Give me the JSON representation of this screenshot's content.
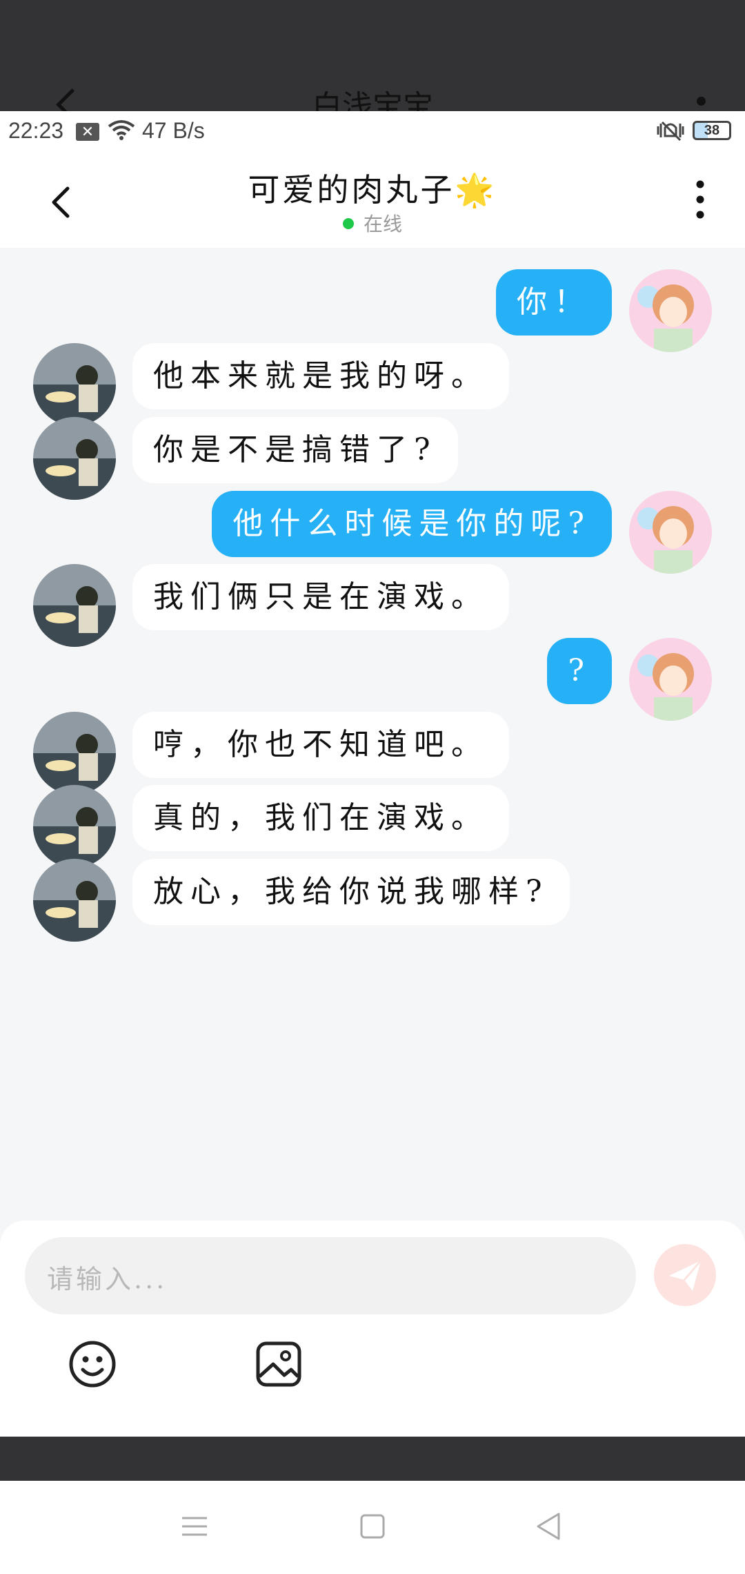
{
  "background_screen": {
    "title": "白浅宝宝"
  },
  "status_bar": {
    "time": "22:23",
    "net_speed": "47 B/s",
    "battery": "38"
  },
  "header": {
    "title": "可爱的肉丸子🌟",
    "presence": "在线"
  },
  "messages": [
    {
      "side": "right",
      "text": "你！"
    },
    {
      "side": "left",
      "text": "他本来就是我的呀。"
    },
    {
      "side": "left",
      "text": "你是不是搞错了?"
    },
    {
      "side": "right",
      "text": "他什么时候是你的呢?"
    },
    {
      "side": "left",
      "text": "我们俩只是在演戏。"
    },
    {
      "side": "right",
      "text": "?"
    },
    {
      "side": "left",
      "text": "哼，你也不知道吧。"
    },
    {
      "side": "left",
      "text": "真的，我们在演戏。"
    },
    {
      "side": "left",
      "text": "放心，我给你说我哪样?"
    }
  ],
  "composer": {
    "placeholder": "请输入..."
  },
  "icons": {
    "back": "chevron-left-icon",
    "more": "more-vertical-icon",
    "send": "send-icon",
    "emoji": "emoji-icon",
    "image": "image-icon"
  },
  "colors": {
    "sent_bubble": "#26b0f5",
    "received_bubble": "#ffffff",
    "online": "#1ec94a",
    "send_button": "#fde3e0"
  }
}
